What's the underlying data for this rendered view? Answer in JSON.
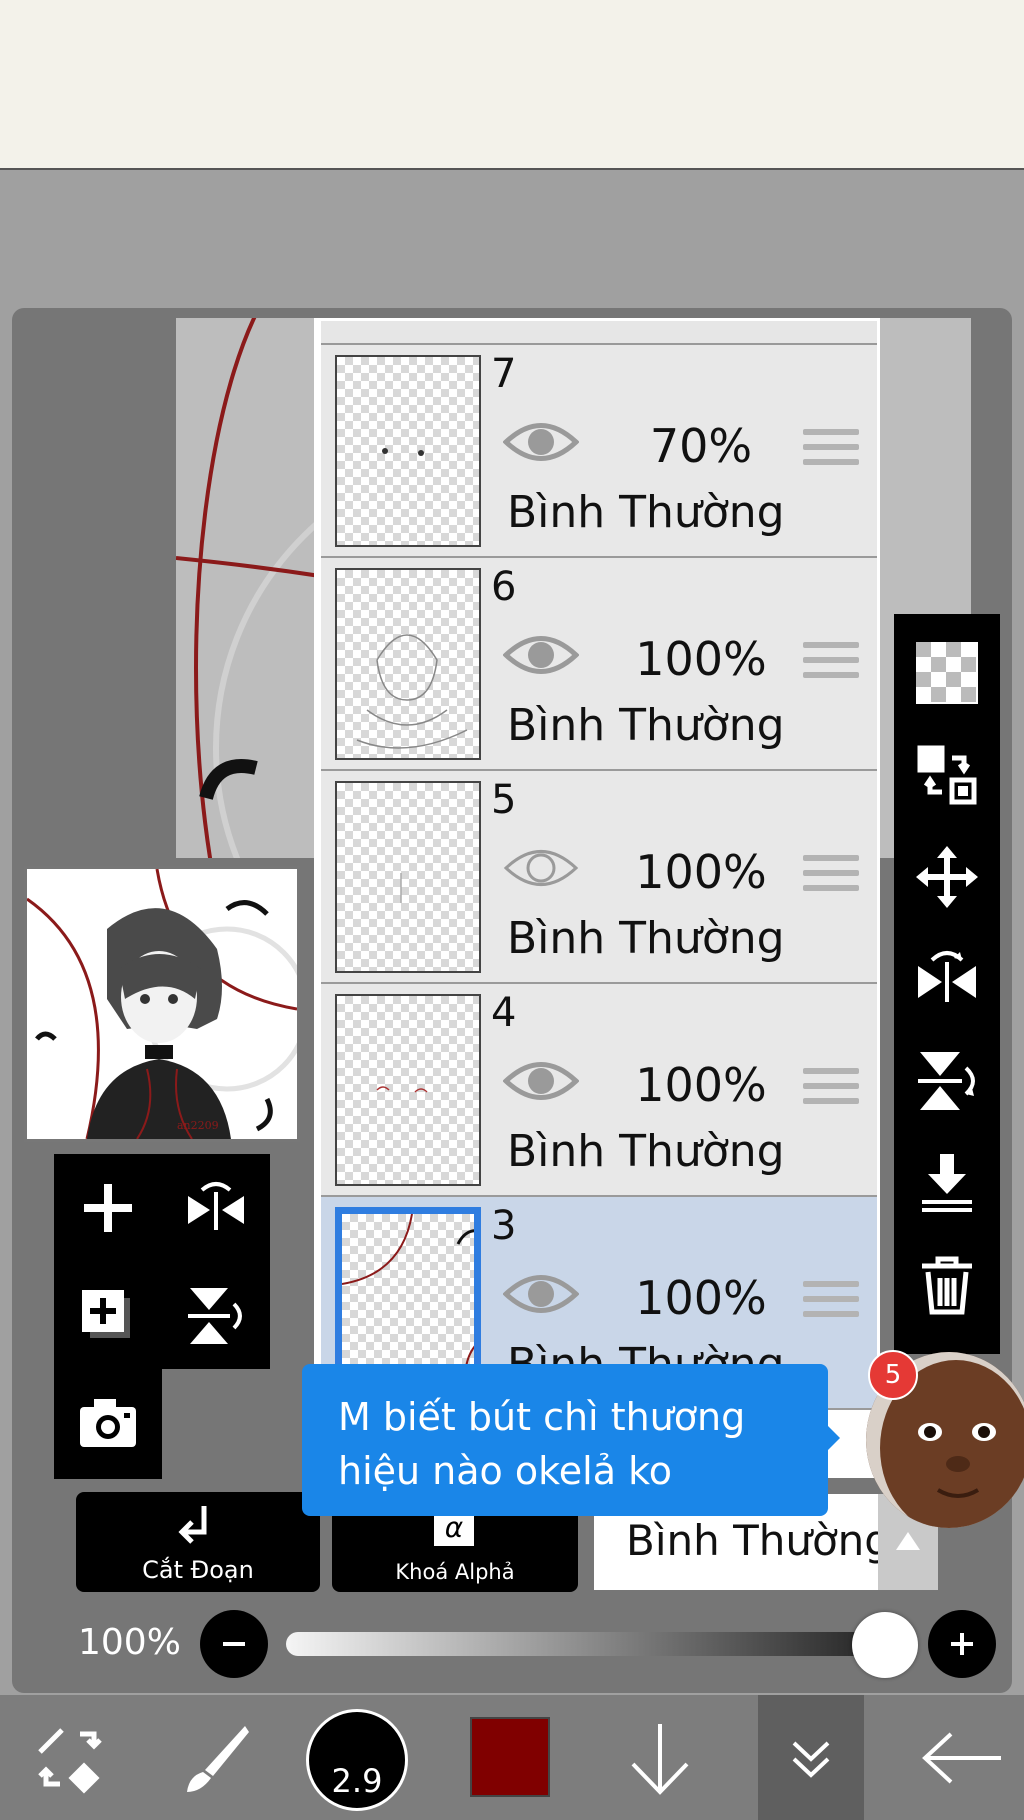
{
  "layers": [
    {
      "number": "7",
      "opacity": "70%",
      "blend": "Bình Thường",
      "visible": true,
      "selected": false
    },
    {
      "number": "6",
      "opacity": "100%",
      "blend": "Bình Thường",
      "visible": true,
      "selected": false
    },
    {
      "number": "5",
      "opacity": "100%",
      "blend": "Bình Thường",
      "visible": false,
      "selected": false
    },
    {
      "number": "4",
      "opacity": "100%",
      "blend": "Bình Thường",
      "visible": true,
      "selected": false
    },
    {
      "number": "3",
      "opacity": "100%",
      "blend": "Bình Thường",
      "visible": true,
      "selected": true
    }
  ],
  "buttons": {
    "clipping_label": "Cắt Đoạn",
    "alpha_lock_label": "Khoá Alphả",
    "alpha_symbol": "α"
  },
  "blend_mode": {
    "selected": "Bình Thường"
  },
  "opacity": {
    "label": "100%",
    "value": 1.0
  },
  "brush": {
    "size": "2.9",
    "color": "#800000"
  },
  "chat_bubble": {
    "message": "M biết bút chì thương hiệu nào okelả ko",
    "badge_count": "5"
  },
  "preview": {
    "signature": "an2209"
  },
  "colors": {
    "accent": "#1a86e8",
    "selected_layer": "#c9d6e8",
    "badge": "#e53935"
  }
}
